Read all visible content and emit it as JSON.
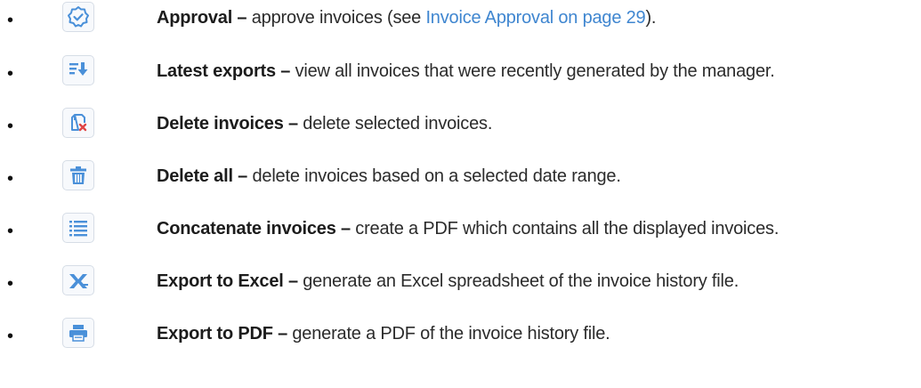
{
  "items": [
    {
      "icon": "approval-badge-icon",
      "title": "Approval –",
      "desc_before": "approve invoices (see",
      "link": "Invoice Approval on page 29",
      "desc_after": ")."
    },
    {
      "icon": "latest-exports-icon",
      "title": "Latest exports –",
      "desc": "view all invoices that were recently generated by the manager."
    },
    {
      "icon": "delete-invoices-icon",
      "title": "Delete invoices –",
      "desc": "delete selected invoices."
    },
    {
      "icon": "trash-icon",
      "title": "Delete all –",
      "desc": "delete invoices based on a selected date range."
    },
    {
      "icon": "list-icon",
      "title": "Concatenate invoices –",
      "desc": "create a PDF which contains all the displayed invoices."
    },
    {
      "icon": "excel-icon",
      "title": "Export to Excel –",
      "desc": "generate an Excel spreadsheet of the invoice history file."
    },
    {
      "icon": "printer-icon",
      "title": "Export to PDF –",
      "desc": "generate a PDF of the invoice history file."
    }
  ],
  "colors": {
    "icon_blue": "#4a90d9",
    "link": "#3f86d0",
    "delete_red": "#e04545"
  },
  "bullet_char": "•"
}
